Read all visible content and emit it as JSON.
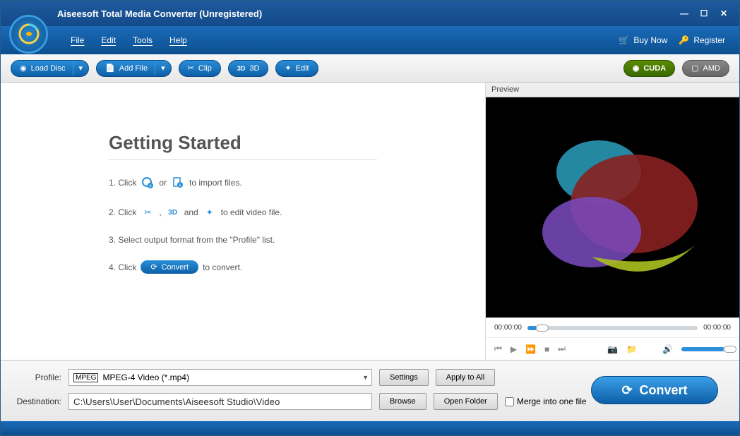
{
  "title": "Aiseesoft Total Media Converter (Unregistered)",
  "menu": {
    "file": "File",
    "edit": "Edit",
    "tools": "Tools",
    "help": "Help"
  },
  "topbuttons": {
    "buy": "Buy Now",
    "register": "Register"
  },
  "toolbar": {
    "load_disc": "Load Disc",
    "add_file": "Add File",
    "clip": "Clip",
    "three_d": "3D",
    "edit": "Edit",
    "cuda": "CUDA",
    "amd": "AMD"
  },
  "getting_started": {
    "heading": "Getting Started",
    "s1_a": "1. Click",
    "s1_or": "or",
    "s1_b": "to import files.",
    "s2_a": "2. Click",
    "s2_comma": ",",
    "s2_and": "and",
    "s2_b": "to edit video file.",
    "s3": "3. Select output format from the \"Profile\" list.",
    "s4_a": "4. Click",
    "s4_convert": "Convert",
    "s4_b": "to convert."
  },
  "preview": {
    "label": "Preview",
    "t1": "00:00:00",
    "t2": "00:00:00"
  },
  "bottom": {
    "profile_label": "Profile:",
    "profile_value": "MPEG-4 Video (*.mp4)",
    "settings": "Settings",
    "apply": "Apply to All",
    "dest_label": "Destination:",
    "dest_value": "C:\\Users\\User\\Documents\\Aiseesoft Studio\\Video",
    "browse": "Browse",
    "open_folder": "Open Folder",
    "merge": "Merge into one file",
    "convert": "Convert"
  }
}
